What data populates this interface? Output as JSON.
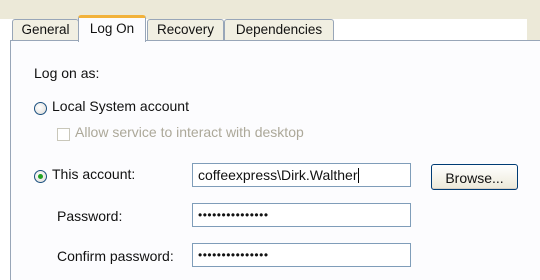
{
  "tabs": [
    {
      "label": "General"
    },
    {
      "label": "Log On"
    },
    {
      "label": "Recovery"
    },
    {
      "label": "Dependencies"
    }
  ],
  "logon": {
    "heading": "Log on as:",
    "local_system_label": "Local System account",
    "allow_interact_label": "Allow service to interact with desktop",
    "this_account_label": "This account:",
    "account_value": "coffeexpress\\Dirk.Walther",
    "browse_label": "Browse...",
    "password_label": "Password:",
    "password_value": "•••••••••••••••",
    "confirm_label": "Confirm password:",
    "confirm_value": "•••••••••••••••",
    "selected_option": "This account"
  }
}
